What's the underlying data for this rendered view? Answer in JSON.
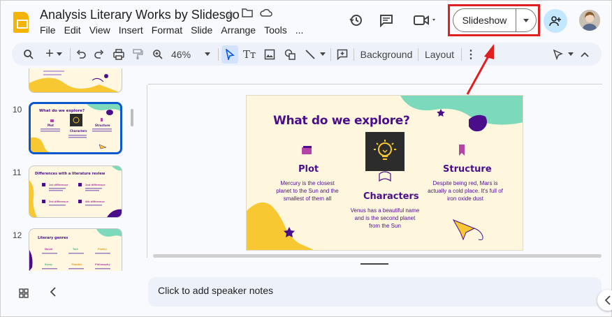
{
  "header": {
    "title": "Analysis Literary Works by Slidesgo",
    "menu": [
      "File",
      "Edit",
      "View",
      "Insert",
      "Format",
      "Slide",
      "Arrange",
      "Tools",
      "..."
    ],
    "slideshow_label": "Slideshow"
  },
  "toolbar": {
    "zoom": "46%",
    "background_label": "Background",
    "layout_label": "Layout"
  },
  "filmstrip": {
    "slides": [
      {
        "number": "10",
        "title": "What do we explore?"
      },
      {
        "number": "11",
        "title": "Differences with a literature review"
      },
      {
        "number": "12",
        "title": "Literary genres"
      }
    ]
  },
  "slide": {
    "title": "What do we explore?",
    "columns": [
      {
        "heading": "Plot",
        "text": "Mercury is the closest planet to the Sun and the smallest of them all"
      },
      {
        "heading": "Characters",
        "text": "Venus has a beautiful name and is the second planet from the Sun"
      },
      {
        "heading": "Structure",
        "text": "Despite being red, Mars is actually a cold place. It's full of iron oxide dust"
      }
    ]
  },
  "notes": {
    "placeholder": "Click to add speaker notes"
  },
  "colors": {
    "accent": "#0b57d0",
    "highlight": "#e02020",
    "slide_purple": "#4b0e8a",
    "slide_mint": "#7dd9bb",
    "slide_yellow": "#f8c832"
  }
}
